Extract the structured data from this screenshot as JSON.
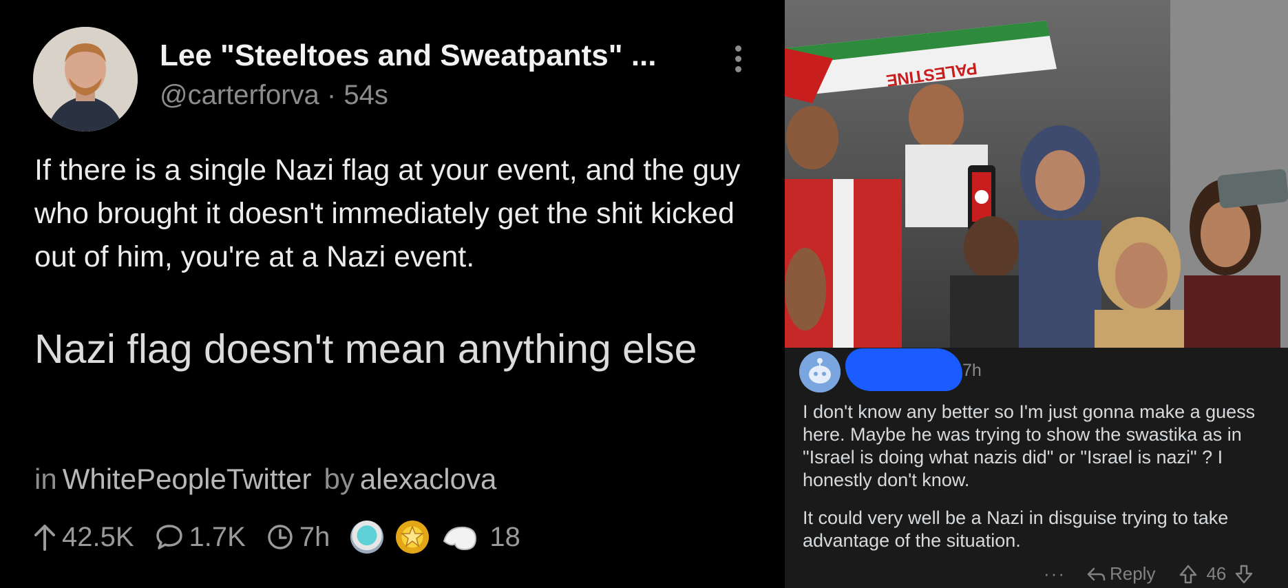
{
  "tweet": {
    "author_name": "Lee \"Steeltoes and Sweatpants\" ...",
    "handle": "@carterforva",
    "separator": "·",
    "age": "54s",
    "text": "If there is a single Nazi flag at your event, and the guy who brought it doesn't immediately get the shit kicked out of him, you're at a Nazi event."
  },
  "post": {
    "title": "Nazi flag doesn't mean anything else",
    "in_label": "in",
    "subreddit": "WhitePeopleTwitter",
    "by_label": "by",
    "author": "alexaclova",
    "upvotes": "42.5K",
    "comments": "1.7K",
    "age": "7h",
    "awards_count": "18"
  },
  "photo": {
    "banner_text": "PALESTINE"
  },
  "comment": {
    "age": "7h",
    "paragraphs": [
      "I don't know any better so I'm just gonna make a guess here. Maybe he was trying to show the swastika as in \"Israel is doing what nazis did\" or \"Israel is nazi\" ? I honestly don't know.",
      "It could very well be a Nazi in disguise trying to take advantage of the situation."
    ],
    "more_label": "···",
    "reply_label": "Reply",
    "score": "46"
  },
  "colors": {
    "redaction": "#1a5cff",
    "comment_bg": "#1a1a1b"
  }
}
